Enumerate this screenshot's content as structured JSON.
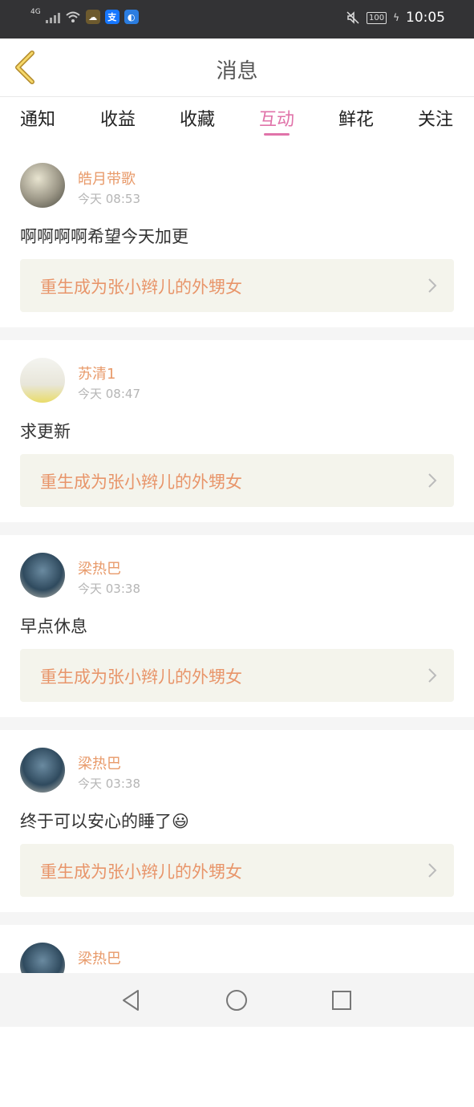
{
  "status_bar": {
    "network": "4G",
    "time": "10:05",
    "battery": "100",
    "app_icons": [
      "weather-icon",
      "alipay-icon",
      "browser-icon"
    ]
  },
  "header": {
    "title": "消息"
  },
  "tabs": [
    {
      "label": "通知"
    },
    {
      "label": "收益"
    },
    {
      "label": "收藏"
    },
    {
      "label": "互动",
      "active": true
    },
    {
      "label": "鲜花"
    },
    {
      "label": "关注"
    }
  ],
  "messages": [
    {
      "user": "皓月带歌",
      "time": "今天 08:53",
      "text": "啊啊啊啊希望今天加更",
      "book": "重生成为张小辫儿的外甥女"
    },
    {
      "user": "苏清1",
      "time": "今天 08:47",
      "text": "求更新",
      "book": "重生成为张小辫儿的外甥女"
    },
    {
      "user": "梁热巴",
      "time": "今天 03:38",
      "text": "早点休息",
      "book": "重生成为张小辫儿的外甥女"
    },
    {
      "user": "梁热巴",
      "time": "今天 03:38",
      "text": "终于可以安心的睡了😃",
      "book": "重生成为张小辫儿的外甥女"
    },
    {
      "user": "梁热巴",
      "time": "",
      "text": "",
      "book": ""
    }
  ],
  "colors": {
    "accent": "#e073a9",
    "username": "#e89a6a",
    "book_link": "#e8956a"
  }
}
